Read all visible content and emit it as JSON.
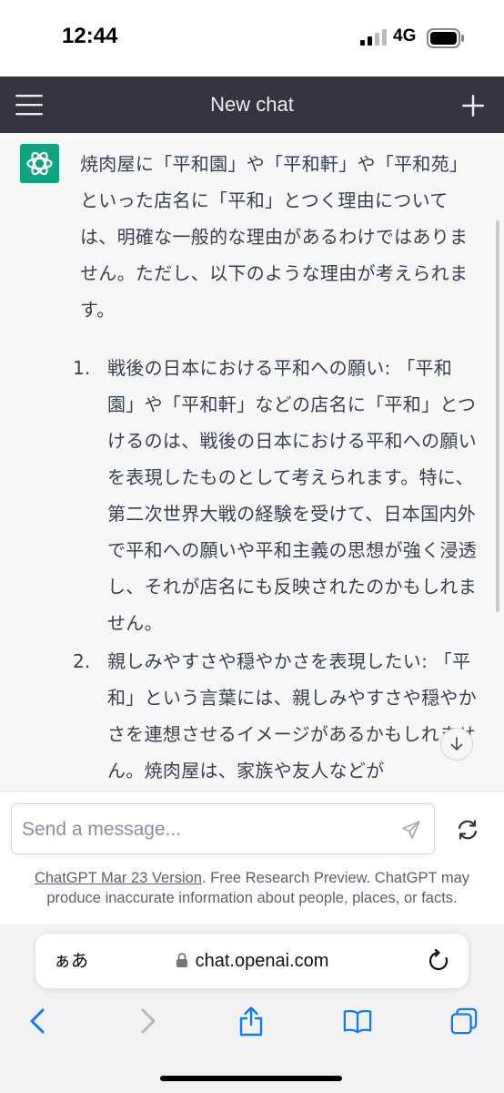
{
  "status_bar": {
    "time": "12:44",
    "network": "4G",
    "icons": [
      "signal-icon",
      "battery-icon"
    ]
  },
  "header": {
    "title": "New chat",
    "icons": [
      "menu-icon",
      "plus-icon"
    ]
  },
  "message": {
    "avatar_icon": "openai-logo-icon",
    "intro": "焼肉屋に「平和園」や「平和軒」や「平和苑」といった店名に「平和」とつく理由については、明確な一般的な理由があるわけではありません。ただし、以下のような理由が考えられます。",
    "list": [
      {
        "num": "1.",
        "text": "戦後の日本における平和への願い: 「平和園」や「平和軒」などの店名に「平和」とつけるのは、戦後の日本における平和への願いを表現したものとして考えられます。特に、第二次世界大戦の経験を受けて、日本国内外で平和への願いや平和主義の思想が強く浸透し、それが店名にも反映されたのかもしれません。"
      },
      {
        "num": "2.",
        "text": "親しみやすさや穏やかさを表現したい: 「平和」という言葉には、親しみやすさや穏やかさを連想させるイメージがあるかもしれません。焼肉屋は、家族や友人などが"
      }
    ],
    "scroll_icon": "arrow-down-icon"
  },
  "composer": {
    "placeholder": "Send a message...",
    "send_icon": "send-icon",
    "regenerate_icon": "refresh-icon"
  },
  "footer": {
    "version_link": "ChatGPT Mar 23 Version",
    "disclaimer": ". Free Research Preview. ChatGPT may produce inaccurate information about people, places, or facts."
  },
  "safari": {
    "aa_label": "ぁあ",
    "url": "chat.openai.com",
    "icons": [
      "lock-icon",
      "reload-icon",
      "back-icon",
      "forward-icon",
      "share-icon",
      "bookmarks-icon",
      "tabs-icon"
    ]
  },
  "colors": {
    "header_bg": "#343541",
    "chat_bg": "#f7f7f8",
    "accent": "#10a37f",
    "safari_blue": "#0a7aff"
  }
}
